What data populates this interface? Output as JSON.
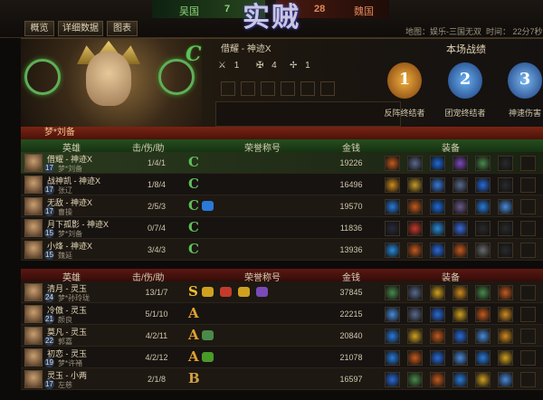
{
  "header": {
    "team_left": {
      "name": "吴国",
      "score": "7"
    },
    "team_right": {
      "name": "魏国",
      "score": "28"
    },
    "emblem_text": "实贼",
    "map": "地图：娱乐-三国无双",
    "time": "时间： 22分7秒"
  },
  "tabs": [
    {
      "label": "概览"
    },
    {
      "label": "详细数据"
    },
    {
      "label": "图表"
    }
  ],
  "hero_panel": {
    "title": "借耀 - 神迹X",
    "grade": "C",
    "stats": [
      {
        "icon": "crossed-swords-icon",
        "value": "1"
      },
      {
        "icon": "skull-icon",
        "value": "4"
      },
      {
        "icon": "assist-icon",
        "value": "1"
      }
    ],
    "equipment_colors": [
      "#c45a1e",
      "#5a6a8a",
      "#1e6ad8",
      "#7a4ab8",
      "#4a8a4a",
      "#2a2a2a"
    ]
  },
  "performance": {
    "title": "本场战绩",
    "medals": [
      {
        "label": "反阵终结者",
        "number": "1",
        "color": "#d07a2a"
      },
      {
        "label": "团宠终结者",
        "number": "2",
        "color": "#3a8ad8"
      },
      {
        "label": "神速伤害",
        "number": "3",
        "color": "#4a8ad8"
      }
    ]
  },
  "player_name": "梦*刘备",
  "columns": {
    "hero": "英雄",
    "kda": "击/伤/助",
    "honor": "荣誉称号",
    "gold": "金钱",
    "equip": "装备"
  },
  "team1": [
    {
      "hero": "借耀 - 神迹X",
      "player": "梦*刘备",
      "level": "17",
      "kda": "1/4/1",
      "grade": "C",
      "gold": "19226",
      "honors": [],
      "equip": [
        "#c45a1e",
        "#5a6a8a",
        "#1e6ad8",
        "#7a4ab8",
        "#4a8a4a",
        "#2a2a2a"
      ]
    },
    {
      "hero": "战神凯 - 神迹X",
      "player": "张辽",
      "level": "17",
      "kda": "1/8/4",
      "grade": "C",
      "gold": "16496",
      "honors": [],
      "equip": [
        "#d08a1e",
        "#c49a2a",
        "#3a7ad8",
        "#5a6a8a",
        "#2a6ad8",
        "#2a2a2a"
      ]
    },
    {
      "hero": "无敌 - 神迹X",
      "player": "曹操",
      "level": "17",
      "kda": "2/5/3",
      "grade": "C",
      "gold": "19570",
      "honors": [
        "#2a7ad8"
      ],
      "equip": [
        "#2a7ad8",
        "#c45a1e",
        "#1e6ad8",
        "#6a5a8a",
        "#2a7ad8",
        "#4a8ad8"
      ]
    },
    {
      "hero": "月下孤影 - 神迹X",
      "player": "梦*刘备",
      "level": "15",
      "kda": "0/7/4",
      "grade": "C",
      "gold": "11836",
      "honors": [],
      "equip": [
        "#2a2a3a",
        "#c43a2a",
        "#2a8ad8",
        "#3a6ad8",
        "#2a2a2a",
        "#2a2a2a"
      ]
    },
    {
      "hero": "小烽 - 神迹X",
      "player": "魏延",
      "level": "15",
      "kda": "3/4/3",
      "grade": "C",
      "gold": "13936",
      "honors": [],
      "equip": [
        "#2a8ad8",
        "#c45a1e",
        "#2a6ad8",
        "#c45a1e",
        "#6a6a6a",
        "#2a2a2a"
      ]
    }
  ],
  "team2": [
    {
      "hero": "清月 - 灵玉",
      "player": "梦*孙玲珑",
      "level": "24",
      "kda": "13/1/7",
      "grade": "S",
      "gold": "37845",
      "honors": [
        "#d0a020",
        "#c43a2a",
        "#d0a020",
        "#7a4ab8"
      ],
      "equip": [
        "#4a8a4a",
        "#5a6a8a",
        "#d0a020",
        "#d08a1e",
        "#4a8a4a",
        "#c45a1e"
      ]
    },
    {
      "hero": "冷傲 - 灵玉",
      "player": "颜良",
      "level": "21",
      "kda": "5/1/10",
      "grade": "A",
      "gold": "22215",
      "honors": [],
      "equip": [
        "#4a8ad8",
        "#5a6a8a",
        "#2a6ad8",
        "#d0a020",
        "#c45a1e",
        "#d08a1e"
      ]
    },
    {
      "hero": "莫凡 - 灵玉",
      "player": "郭嘉",
      "level": "22",
      "kda": "4/2/11",
      "grade": "A",
      "gold": "20840",
      "honors": [
        "#4a8a4a"
      ],
      "equip": [
        "#2a7ad8",
        "#d0a020",
        "#c45a1e",
        "#2a6ad8",
        "#4a8ad8",
        "#d08a1e"
      ]
    },
    {
      "hero": "初恋 - 灵玉",
      "player": "梦*许褚",
      "level": "19",
      "kda": "4/2/12",
      "grade": "A",
      "gold": "21078",
      "honors": [
        "#4a9a2a"
      ],
      "equip": [
        "#2a7ad8",
        "#c45a1e",
        "#2a6ad8",
        "#4a8ad8",
        "#2a7ad8",
        "#d0a020"
      ]
    },
    {
      "hero": "灵玉 - 小两",
      "player": "左慈",
      "level": "17",
      "kda": "2/1/8",
      "grade": "B",
      "gold": "16597",
      "honors": [],
      "equip": [
        "#2a6ad8",
        "#4a8a4a",
        "#c45a1e",
        "#2a7ad8",
        "#d0a020",
        "#4a8ad8"
      ]
    }
  ],
  "colors": {
    "team1_header": "#1f4a1a",
    "team2_header": "#4a1210",
    "gold_text": "#e0c070"
  }
}
